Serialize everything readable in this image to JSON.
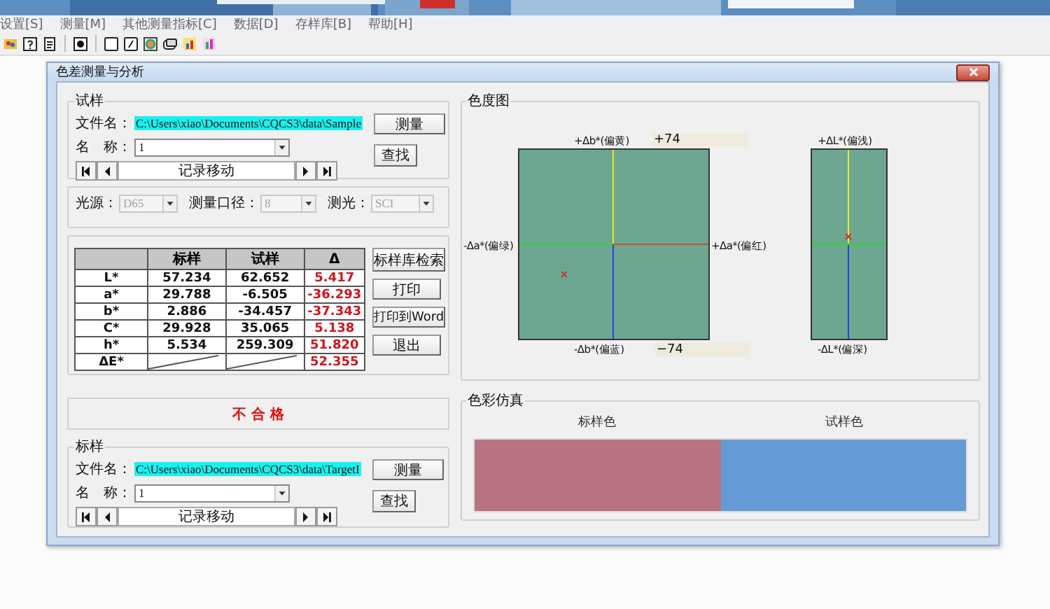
{
  "menu_bar": [
    "设置[S]",
    "测量[M]",
    "其他测量指标[C]",
    "数据[D]",
    "存样库[B]",
    "帮助[H]"
  ],
  "window": {
    "title": "色差测量与分析"
  },
  "sample": {
    "title": "试样",
    "file_label": "文件名：",
    "file": "C:\\Users\\xiao\\Documents\\CQCS3\\data\\Sample",
    "name_label": "名　称：",
    "name": "1",
    "nav_label": "记录移动",
    "buttons": [
      "测量",
      "查找"
    ]
  },
  "settings": [
    {
      "label": "光源：",
      "value": "D65",
      "disabled": true
    },
    {
      "label": "测量口径：",
      "value": "8",
      "disabled": true
    },
    {
      "label": "测光：",
      "value": "SCI",
      "disabled": true
    }
  ],
  "table": {
    "columns": [
      "标样",
      "试样",
      "Δ"
    ],
    "rows": [
      {
        "label": "L*",
        "standard": "57.234",
        "sample": "62.652",
        "delta": "5.417"
      },
      {
        "label": "a*",
        "standard": "29.788",
        "sample": "-6.505",
        "delta": "-36.293"
      },
      {
        "label": "b*",
        "standard": "2.886",
        "sample": "-34.457",
        "delta": "-37.343"
      },
      {
        "label": "C*",
        "standard": "29.928",
        "sample": "35.065",
        "delta": "5.138"
      },
      {
        "label": "h*",
        "standard": "5.534",
        "sample": "259.309",
        "delta": "51.820"
      },
      {
        "label": "ΔE*",
        "delta": "52.355"
      }
    ]
  },
  "side_buttons": [
    "标样库检索",
    "打印",
    "打印到Word",
    "退出"
  ],
  "result": "不 合 格",
  "standard": {
    "title": "标样",
    "file_label": "文件名：",
    "file": "C:\\Users\\xiao\\Documents\\CQCS3\\data\\TargetI",
    "name_label": "名　称：",
    "name": "1",
    "nav_label": "记录移动",
    "buttons": [
      "测量",
      "查找"
    ]
  },
  "chromaticity": {
    "title": "色度图",
    "b_plus": "+Δb*(偏黄)",
    "b_max": "+74",
    "a_minus": "-Δa*(偏绿)",
    "a_plus": "+Δa*(偏红)",
    "b_minus": "-Δb*(偏蓝)",
    "b_min": "−74",
    "l_plus": "+ΔL*(偏浅)",
    "l_minus": "-ΔL*(偏深)"
  },
  "simulation": {
    "title": "色彩仿真",
    "swatches": [
      {
        "label": "标样色",
        "color": "#b87282"
      },
      {
        "label": "试样色",
        "color": "#669ad4"
      }
    ]
  }
}
